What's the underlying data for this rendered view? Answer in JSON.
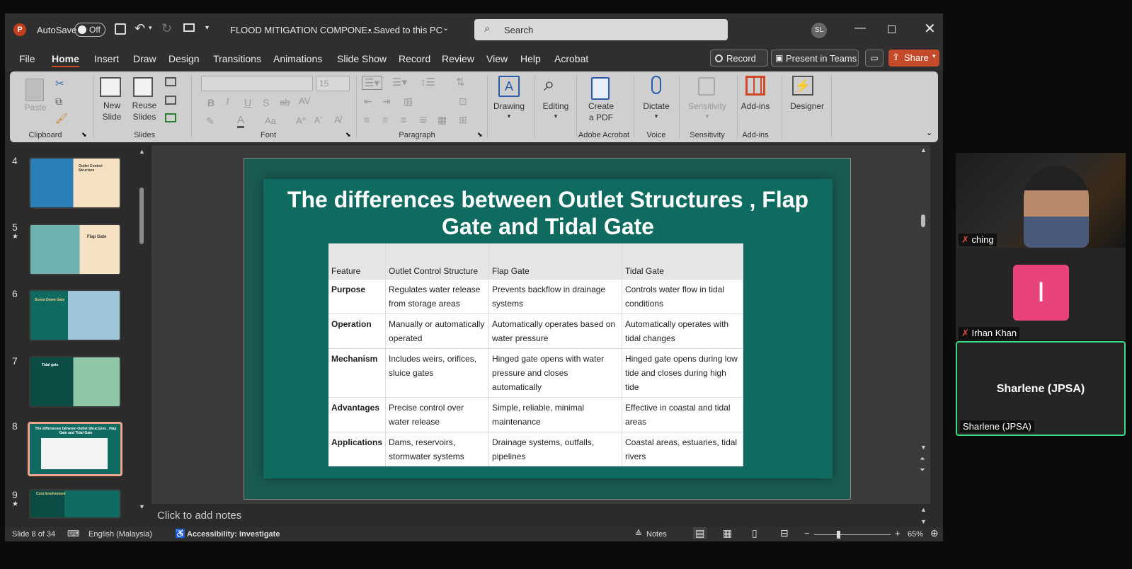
{
  "titlebar": {
    "autosave_label": "AutoSave",
    "autosave_state": "Off",
    "doc_title": "FLOOD MITIGATION COMPONE...",
    "save_status": "• Saved to this PC",
    "search_placeholder": "Search",
    "user_initials": "SL"
  },
  "menu": [
    "File",
    "Home",
    "Insert",
    "Draw",
    "Design",
    "Transitions",
    "Animations",
    "Slide Show",
    "Record",
    "Review",
    "View",
    "Help",
    "Acrobat"
  ],
  "menu_active": "Home",
  "right_buttons": {
    "record": "Record",
    "present": "Present in Teams",
    "share": "Share"
  },
  "ribbon": {
    "paste": "Paste",
    "new_slide_1": "New",
    "new_slide_2": "Slide",
    "reuse_1": "Reuse",
    "reuse_2": "Slides",
    "font_size": "15",
    "drawing": "Drawing",
    "editing": "Editing",
    "create_pdf_1": "Create",
    "create_pdf_2": "a PDF",
    "dictate": "Dictate",
    "sensitivity": "Sensitivity",
    "addins": "Add-ins",
    "designer": "Designer",
    "groups": {
      "clipboard": "Clipboard",
      "slides": "Slides",
      "font": "Font",
      "paragraph": "Paragraph",
      "adobe": "Adobe Acrobat",
      "voice": "Voice",
      "sensitivity": "Sensitivity",
      "addins": "Add-ins"
    }
  },
  "thumbnails": [
    {
      "num": "4",
      "title": "Outlet Control Structure"
    },
    {
      "num": "5",
      "title": "Flap Gate"
    },
    {
      "num": "6",
      "title": "Screw Down Gate"
    },
    {
      "num": "7",
      "title": "Tidal gate"
    },
    {
      "num": "8",
      "title": "The differences between Outlet Structures , Flap Gate and Tidal Gate"
    },
    {
      "num": "9",
      "title": "Cost Involvement"
    }
  ],
  "slide": {
    "title": "The differences between Outlet Structures , Flap Gate and Tidal Gate",
    "headers": [
      "Feature",
      "Outlet Control Structure",
      "Flap Gate",
      "Tidal Gate"
    ],
    "rows": [
      [
        "Purpose",
        "Regulates water release from storage areas",
        "Prevents backflow in drainage systems",
        "Controls water flow in tidal conditions"
      ],
      [
        "Operation",
        "Manually or automatically operated",
        "Automatically operates based on water pressure",
        "Automatically operates with tidal changes"
      ],
      [
        "Mechanism",
        "Includes weirs, orifices, sluice gates",
        "Hinged gate opens with water pressure and closes automatically",
        "Hinged gate opens during low tide and closes during high tide"
      ],
      [
        "Advantages",
        "Precise control over water release",
        "Simple, reliable, minimal maintenance",
        "Effective in coastal and tidal areas"
      ],
      [
        "Applications",
        "Dams, reservoirs, stormwater systems",
        "Drainage systems, outfalls, pipelines",
        "Coastal areas, estuaries, tidal rivers"
      ]
    ]
  },
  "notes_placeholder": "Click to add notes",
  "status": {
    "slide_of": "Slide 8 of 34",
    "language": "English (Malaysia)",
    "accessibility": "Accessibility: Investigate",
    "notes": "Notes",
    "zoom": "65%"
  },
  "participants": [
    {
      "name": "ching",
      "muted": true
    },
    {
      "name": "Irhan Khan",
      "initial": "I",
      "muted": true
    },
    {
      "name": "Sharlene (JPSA)",
      "display": "Sharlene (JPSA)"
    }
  ],
  "colors": {
    "accent": "#c43e1c",
    "slide_bg": "#0f6a60",
    "speaking": "#3ddc84",
    "avatar": "#e8447a"
  }
}
